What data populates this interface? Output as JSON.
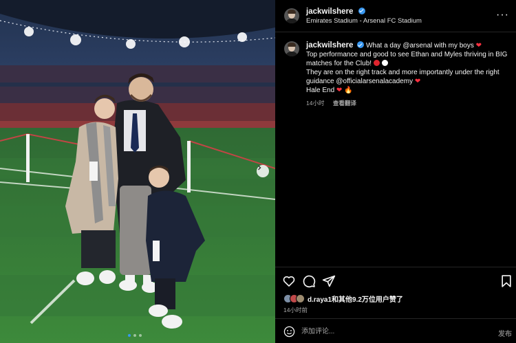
{
  "post": {
    "username": "jackwilshere",
    "location": "Emirates Stadium - Arsenal FC Stadium",
    "more_label": "···",
    "caption": {
      "line1_prefix": "What a day ",
      "mention_arsenal": "@arsenal",
      "line1_suffix": " with my boys",
      "line2": "Top performance and good to see Ethan and Myles thriving in BIG matches for the Club!",
      "line3_prefix": "They are on the right track and more importantly under the right guidance ",
      "mention_academy": "@officialarsenalacademy",
      "line4": "Hale End"
    },
    "caption_time": "14小时",
    "see_translation": "查看翻译",
    "likes_text": "d.raya1和其他9.2万位用户赞了",
    "time_ago": "14小时前",
    "comment_placeholder": "添加评论...",
    "post_label": "发布",
    "carousel": {
      "count": 3,
      "active": 0
    }
  },
  "icons": [
    "verified-icon",
    "more-icon",
    "heart-icon",
    "comment-icon",
    "share-icon",
    "bookmark-icon",
    "emoji-icon",
    "next-arrow-icon"
  ],
  "colors": {
    "accent": "#3897f0",
    "heart": "#ff3040",
    "background": "#000000",
    "muted": "#a8a8a8"
  }
}
